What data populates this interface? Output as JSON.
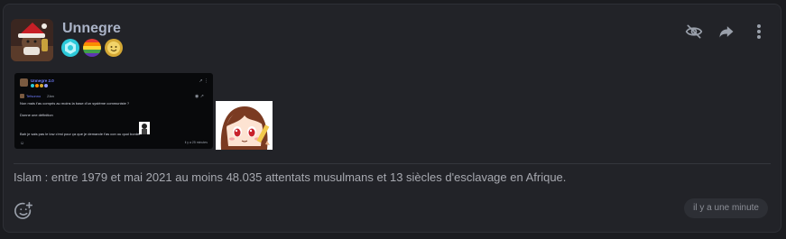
{
  "post": {
    "username": "Unnegre",
    "message": "Islam : entre 1979 et mai 2021 au moins 48.035 attentats musulmans et 13 siècles d'esclavage en Afrique.",
    "timestamp": "il y a une minute",
    "badges": [
      "cyan-hexagon-badge",
      "rainbow-badge",
      "gold-smiley-badge"
    ],
    "actions": [
      "hide-icon",
      "share-icon",
      "more-options-icon"
    ],
    "reaction_icon": "add-reaction-icon"
  },
  "embedded_screenshot": {
    "username": "Unnegre 2.0",
    "reply_author": "Tefsonno",
    "reply_tag": "Zâm",
    "line1": "Non mais t'as compris au moins la base d'un système communiste ?",
    "line2": "Donne une définition",
    "line3": "Bah je sais pas le low c'est pour ça que je demande t'as con ou quoi bordel",
    "time": "il y a 25 minutes"
  },
  "colors": {
    "background": "#1b1c20",
    "card": "#222328",
    "username": "#aab3c7",
    "embed_accent": "#6f7dff"
  }
}
